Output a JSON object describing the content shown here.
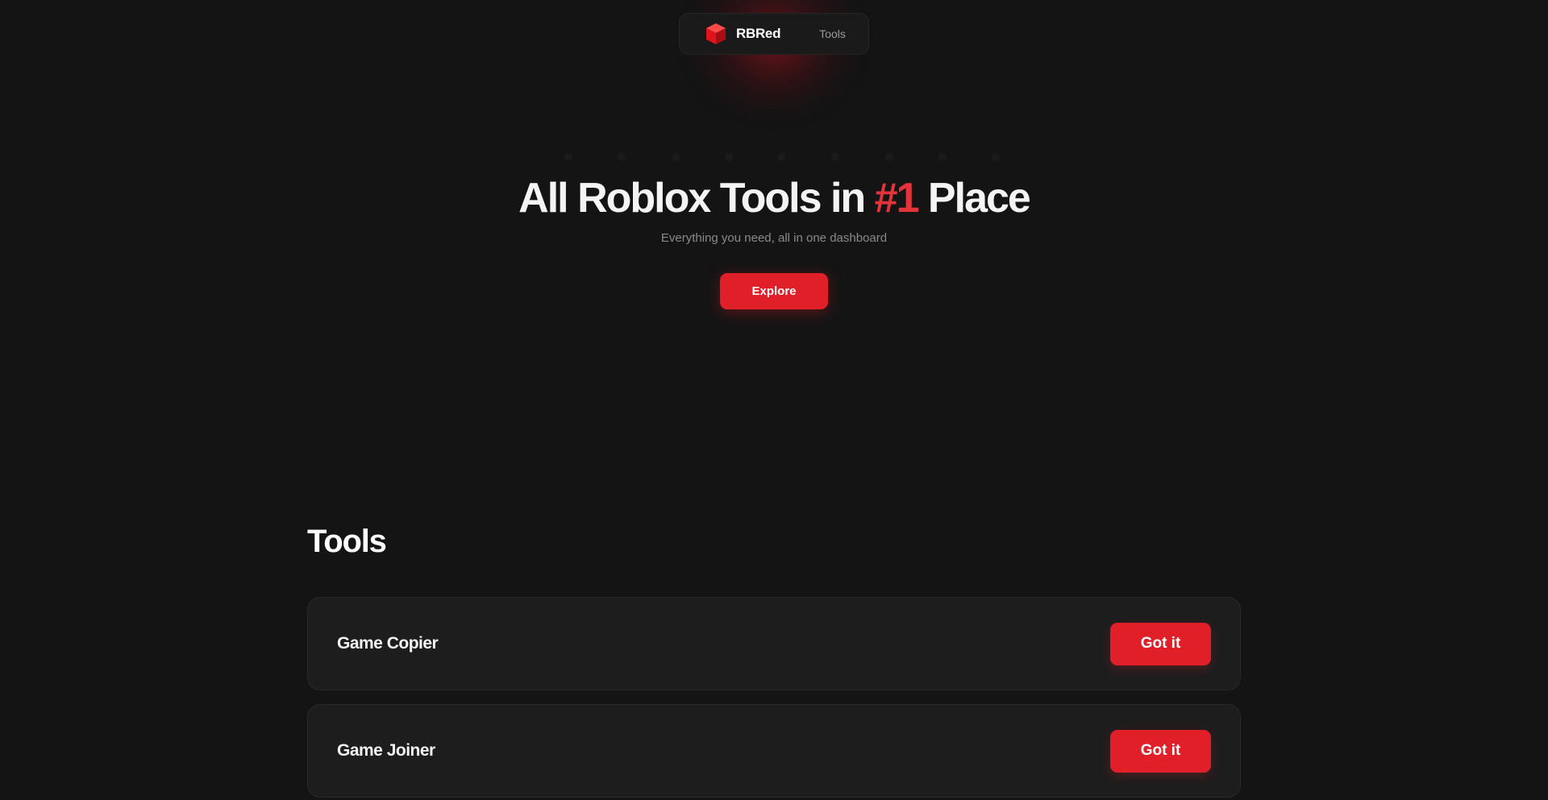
{
  "colors": {
    "background": "#141414",
    "accent": "#e01f28",
    "accent_text": "#e5333b",
    "card": "#1d1d1d"
  },
  "navbar": {
    "brand_icon": "red-cube-icon",
    "brand_name": "RBRed",
    "links": [
      {
        "label": "Tools"
      }
    ]
  },
  "hero": {
    "title_before": "All Roblox Tools in ",
    "title_accent": "#1",
    "title_after": " Place",
    "subtitle": "Everything you need, all in one dashboard",
    "cta_label": "Explore"
  },
  "tools": {
    "heading": "Tools",
    "items": [
      {
        "name": "Game Copier",
        "button_label": "Got it"
      },
      {
        "name": "Game Joiner",
        "button_label": "Got it"
      }
    ]
  }
}
